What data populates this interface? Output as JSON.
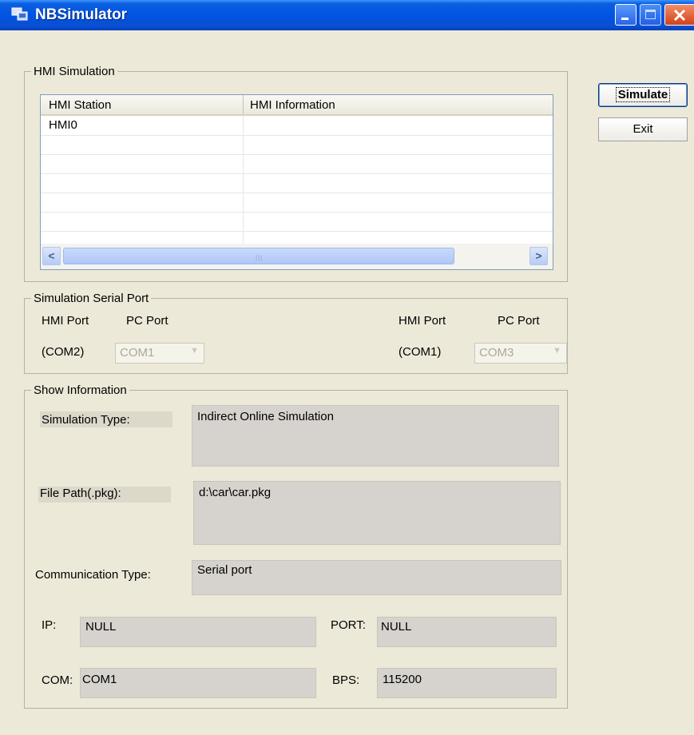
{
  "window": {
    "title": "NBSimulator",
    "icon": "app-window-icon",
    "controls": [
      "minimize-icon",
      "maximize-icon",
      "close-icon"
    ]
  },
  "buttons": {
    "simulate": "Simulate",
    "exit": "Exit"
  },
  "hmi_simulation": {
    "legend": "HMI Simulation",
    "columns": [
      "HMI Station",
      "HMI Information"
    ],
    "rows": [
      {
        "station": "HMI0",
        "info": ""
      }
    ],
    "scroll_left_glyph": "<",
    "scroll_right_glyph": ">"
  },
  "serial_port": {
    "legend": "Simulation Serial Port",
    "left": {
      "hmi_port_header": "HMI Port",
      "pc_port_header": "PC Port",
      "hmi_port_value": "(COM2)",
      "pc_port_value": "COM1"
    },
    "right": {
      "hmi_port_header": "HMI Port",
      "pc_port_header": "PC Port",
      "hmi_port_value": "(COM1)",
      "pc_port_value": "COM3"
    }
  },
  "show_information": {
    "legend": "Show Information",
    "simulation_type_label": "Simulation Type:",
    "simulation_type_value": "Indirect Online Simulation",
    "file_path_label": "File Path(.pkg):",
    "file_path_value": "d:\\car\\car.pkg",
    "communication_type_label": "Communication Type:",
    "communication_type_value": "Serial port",
    "ip_label": "IP:",
    "ip_value": "NULL",
    "port_label": "PORT:",
    "port_value": "NULL",
    "com_label": "COM:",
    "com_value": "COM1",
    "bps_label": "BPS:",
    "bps_value": "115200"
  }
}
